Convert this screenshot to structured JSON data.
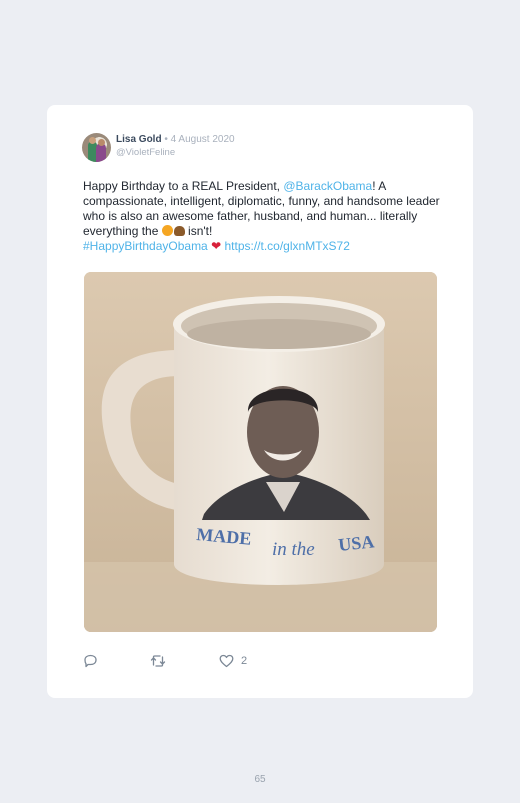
{
  "tweet": {
    "author_name": "Lisa Gold",
    "separator": "•",
    "date": "4 August 2020",
    "handle": "@VioletFeline",
    "text": {
      "part1": "Happy Birthday to a REAL President, ",
      "mention": "@BarackObama",
      "part2": "! A compassionate, intelligent, diplomatic, funny, and handsome leader who is also an awesome father, husband, and human... literally everything the ",
      "part3": " isn't! ",
      "hashtag": "#HappyBirthdayObama",
      "heart": "❤",
      "url": "https://t.co/glxnMTxS72"
    },
    "image": {
      "mug_text_made": "MADE",
      "mug_text_in_the": "in the",
      "mug_text_usa": "USA"
    },
    "actions": {
      "like_count": "2"
    },
    "icons": {
      "reply": "reply-icon",
      "retweet": "retweet-icon",
      "like": "heart-icon"
    }
  },
  "page": {
    "number": "65"
  }
}
